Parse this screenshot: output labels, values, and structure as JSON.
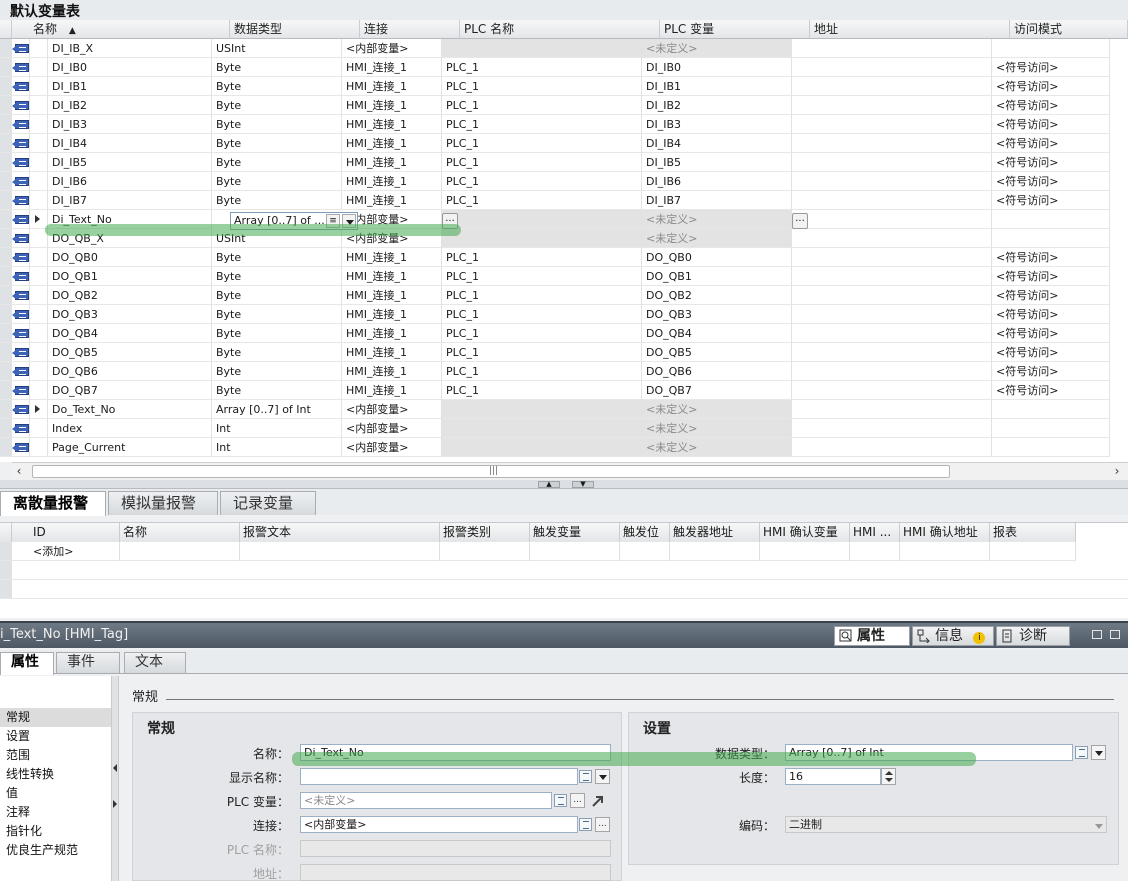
{
  "tag_table": {
    "title": "默认变量表",
    "columns": {
      "name": "名称",
      "data_type": "数据类型",
      "connection": "连接",
      "plc_name": "PLC 名称",
      "plc_tag": "PLC 变量",
      "address": "地址",
      "access_mode": "访问模式"
    },
    "sort_indicator": "▲",
    "rows": [
      {
        "name": "DI_IB_X",
        "type": "USInt",
        "conn": "<内部变量>",
        "plc": "",
        "var": "<未定义>",
        "access": ""
      },
      {
        "name": "DI_IB0",
        "type": "Byte",
        "conn": "HMI_连接_1",
        "plc": "PLC_1",
        "var": "DI_IB0",
        "access": "<符号访问>"
      },
      {
        "name": "DI_IB1",
        "type": "Byte",
        "conn": "HMI_连接_1",
        "plc": "PLC_1",
        "var": "DI_IB1",
        "access": "<符号访问>"
      },
      {
        "name": "DI_IB2",
        "type": "Byte",
        "conn": "HMI_连接_1",
        "plc": "PLC_1",
        "var": "DI_IB2",
        "access": "<符号访问>"
      },
      {
        "name": "DI_IB3",
        "type": "Byte",
        "conn": "HMI_连接_1",
        "plc": "PLC_1",
        "var": "DI_IB3",
        "access": "<符号访问>"
      },
      {
        "name": "DI_IB4",
        "type": "Byte",
        "conn": "HMI_连接_1",
        "plc": "PLC_1",
        "var": "DI_IB4",
        "access": "<符号访问>"
      },
      {
        "name": "DI_IB5",
        "type": "Byte",
        "conn": "HMI_连接_1",
        "plc": "PLC_1",
        "var": "DI_IB5",
        "access": "<符号访问>"
      },
      {
        "name": "DI_IB6",
        "type": "Byte",
        "conn": "HMI_连接_1",
        "plc": "PLC_1",
        "var": "DI_IB6",
        "access": "<符号访问>"
      },
      {
        "name": "DI_IB7",
        "type": "Byte",
        "conn": "HMI_连接_1",
        "plc": "PLC_1",
        "var": "DI_IB7",
        "access": "<符号访问>"
      },
      {
        "name": "Di_Text_No",
        "type": "Array [0..7] of ...",
        "conn": "<内部变量>",
        "plc": "",
        "var": "<未定义>",
        "access": "",
        "expandable": true,
        "selected": true
      },
      {
        "name": "DO_QB_X",
        "type": "USInt",
        "conn": "<内部变量>",
        "plc": "",
        "var": "<未定义>",
        "access": ""
      },
      {
        "name": "DO_QB0",
        "type": "Byte",
        "conn": "HMI_连接_1",
        "plc": "PLC_1",
        "var": "DO_QB0",
        "access": "<符号访问>"
      },
      {
        "name": "DO_QB1",
        "type": "Byte",
        "conn": "HMI_连接_1",
        "plc": "PLC_1",
        "var": "DO_QB1",
        "access": "<符号访问>"
      },
      {
        "name": "DO_QB2",
        "type": "Byte",
        "conn": "HMI_连接_1",
        "plc": "PLC_1",
        "var": "DO_QB2",
        "access": "<符号访问>"
      },
      {
        "name": "DO_QB3",
        "type": "Byte",
        "conn": "HMI_连接_1",
        "plc": "PLC_1",
        "var": "DO_QB3",
        "access": "<符号访问>"
      },
      {
        "name": "DO_QB4",
        "type": "Byte",
        "conn": "HMI_连接_1",
        "plc": "PLC_1",
        "var": "DO_QB4",
        "access": "<符号访问>"
      },
      {
        "name": "DO_QB5",
        "type": "Byte",
        "conn": "HMI_连接_1",
        "plc": "PLC_1",
        "var": "DO_QB5",
        "access": "<符号访问>"
      },
      {
        "name": "DO_QB6",
        "type": "Byte",
        "conn": "HMI_连接_1",
        "plc": "PLC_1",
        "var": "DO_QB6",
        "access": "<符号访问>"
      },
      {
        "name": "DO_QB7",
        "type": "Byte",
        "conn": "HMI_连接_1",
        "plc": "PLC_1",
        "var": "DO_QB7",
        "access": "<符号访问>"
      },
      {
        "name": "Do_Text_No",
        "type": "Array [0..7] of Int",
        "conn": "<内部变量>",
        "plc": "",
        "var": "<未定义>",
        "access": "",
        "expandable": true
      },
      {
        "name": "Index",
        "type": "Int",
        "conn": "<内部变量>",
        "plc": "",
        "var": "<未定义>",
        "access": ""
      },
      {
        "name": "Page_Current",
        "type": "Int",
        "conn": "<内部变量>",
        "plc": "",
        "var": "<未定义>",
        "access": ""
      }
    ],
    "scrollbar_grip": "|||",
    "ellipsis": "..."
  },
  "alarm_tabs": [
    "离散量报警",
    "模拟量报警",
    "记录变量"
  ],
  "alarm_table": {
    "columns": [
      "ID",
      "名称",
      "报警文本",
      "报警类别",
      "触发变量",
      "触发位",
      "触发器地址",
      "HMI 确认变量",
      "HMI ...",
      "HMI 确认地址",
      "报表"
    ],
    "add_label": "<添加>"
  },
  "properties": {
    "title": "i_Text_No [HMI_Tag]",
    "inspector_tabs": [
      "属性",
      "信息",
      "诊断"
    ],
    "tabs": [
      "属性",
      "事件",
      "文本"
    ],
    "nav": [
      "常规",
      "设置",
      "范围",
      "线性转换",
      "值",
      "注释",
      "指针化",
      "优良生产规范"
    ],
    "section_title": "常规",
    "general": {
      "title": "常规",
      "name_label": "名称：",
      "name_value": "Di_Text_No",
      "display_name_label": "显示名称：",
      "display_name_value": "",
      "plc_tag_label": "PLC 变量：",
      "plc_tag_value": "<未定义>",
      "connection_label": "连接：",
      "connection_value": "<内部变量>",
      "plc_name_label": "PLC 名称：",
      "address_label": "地址："
    },
    "settings": {
      "title": "设置",
      "data_type_label": "数据类型：",
      "data_type_value": "Array [0..7] of Int",
      "length_label": "长度：",
      "length_value": "16",
      "encoding_label": "编码：",
      "encoding_value": "二进制"
    }
  }
}
